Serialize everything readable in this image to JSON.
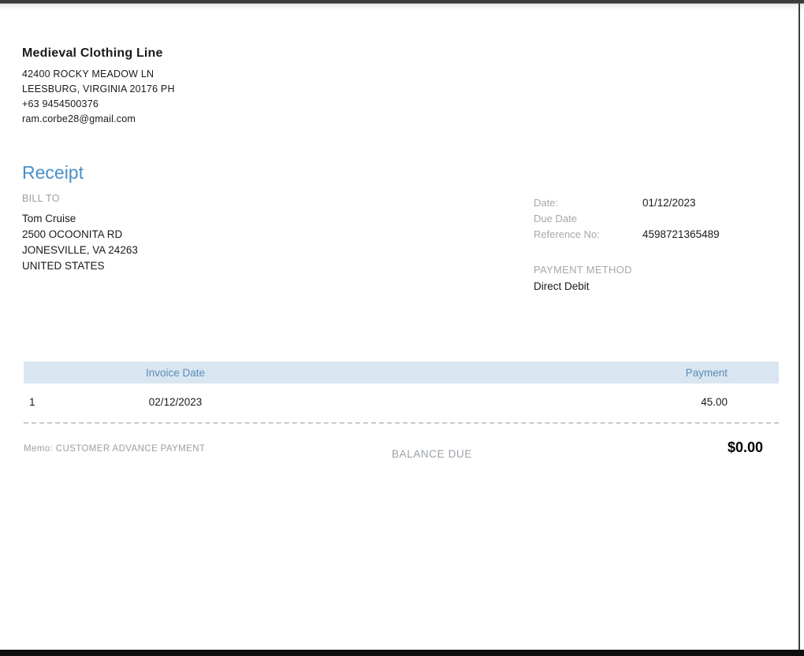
{
  "company": {
    "name": "Medieval Clothing Line",
    "address_line1": "42400 ROCKY MEADOW LN",
    "address_line2": "LEESBURG, VIRGINIA  20176 PH",
    "phone": "+63 9454500376",
    "email": "ram.corbe28@gmail.com"
  },
  "document": {
    "title": "Receipt"
  },
  "bill_to": {
    "label": "BILL TO",
    "name": "Tom Cruise",
    "address_line1": "2500 OCOONITA RD",
    "address_line2": "JONESVILLE, VA  24263",
    "country": "UNITED STATES"
  },
  "details": {
    "date_label": "Date:",
    "date_value": "01/12/2023",
    "due_date_label": "Due Date",
    "reference_label": "Reference No:",
    "reference_value": "4598721365489",
    "payment_method_label": "PAYMENT METHOD",
    "payment_method_value": "Direct Debit"
  },
  "table": {
    "columns": [
      "Invoice Date",
      "Payment"
    ],
    "rows": [
      {
        "num": "1",
        "invoice_date": "02/12/2023",
        "payment": "45.00"
      }
    ]
  },
  "footer": {
    "memo_label": "Memo:",
    "memo_value": "CUSTOMER ADVANCE PAYMENT",
    "balance_due_label": "BALANCE DUE",
    "balance_due_value": "$0.00"
  },
  "colors": {
    "accent_blue": "#4a90c8",
    "table_header_bg": "#d9e6f1",
    "table_header_text": "#5b8db8",
    "label_gray": "#a5a8ac",
    "body_text": "#1a1a1a"
  }
}
